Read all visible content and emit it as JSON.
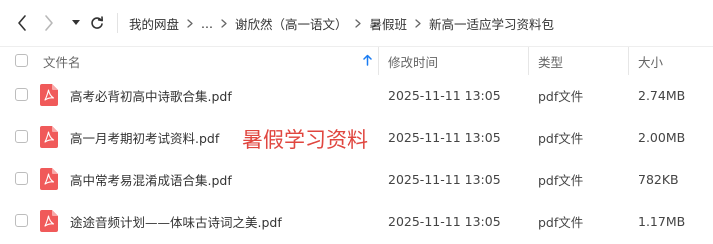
{
  "breadcrumb": [
    "我的网盘",
    "...",
    "谢欣然（高一语文）",
    "暑假班",
    "新高一适应学习资料包"
  ],
  "columns": {
    "name": "文件名",
    "modified": "修改时间",
    "type": "类型",
    "size": "大小"
  },
  "files": [
    {
      "name": "高考必背初高中诗歌合集.pdf",
      "modified": "2025-11-11 13:05",
      "type": "pdf文件",
      "size": "2.74MB"
    },
    {
      "name": "高一月考期初考试资料.pdf",
      "modified": "2025-11-11 13:05",
      "type": "pdf文件",
      "size": "2.00MB"
    },
    {
      "name": "高中常考易混淆成语合集.pdf",
      "modified": "2025-11-11 13:05",
      "type": "pdf文件",
      "size": "782KB"
    },
    {
      "name": "途途音频计划——体味古诗词之美.pdf",
      "modified": "2025-11-11 13:05",
      "type": "pdf文件",
      "size": "1.17MB"
    }
  ],
  "overlay_text": "暑假学习资料",
  "icons": {
    "back": "arrow-left-icon",
    "forward": "arrow-right-icon",
    "dropdown": "caret-down-icon",
    "refresh": "refresh-icon",
    "breadcrumb_separator": "chevron-right-icon",
    "sort": "sort-arrow-up-icon",
    "file": "pdf-file-icon"
  },
  "colors": {
    "accent": "#1a7cf2",
    "pdf_icon": "#f05a5a",
    "overlay_text": "#e0463f"
  }
}
